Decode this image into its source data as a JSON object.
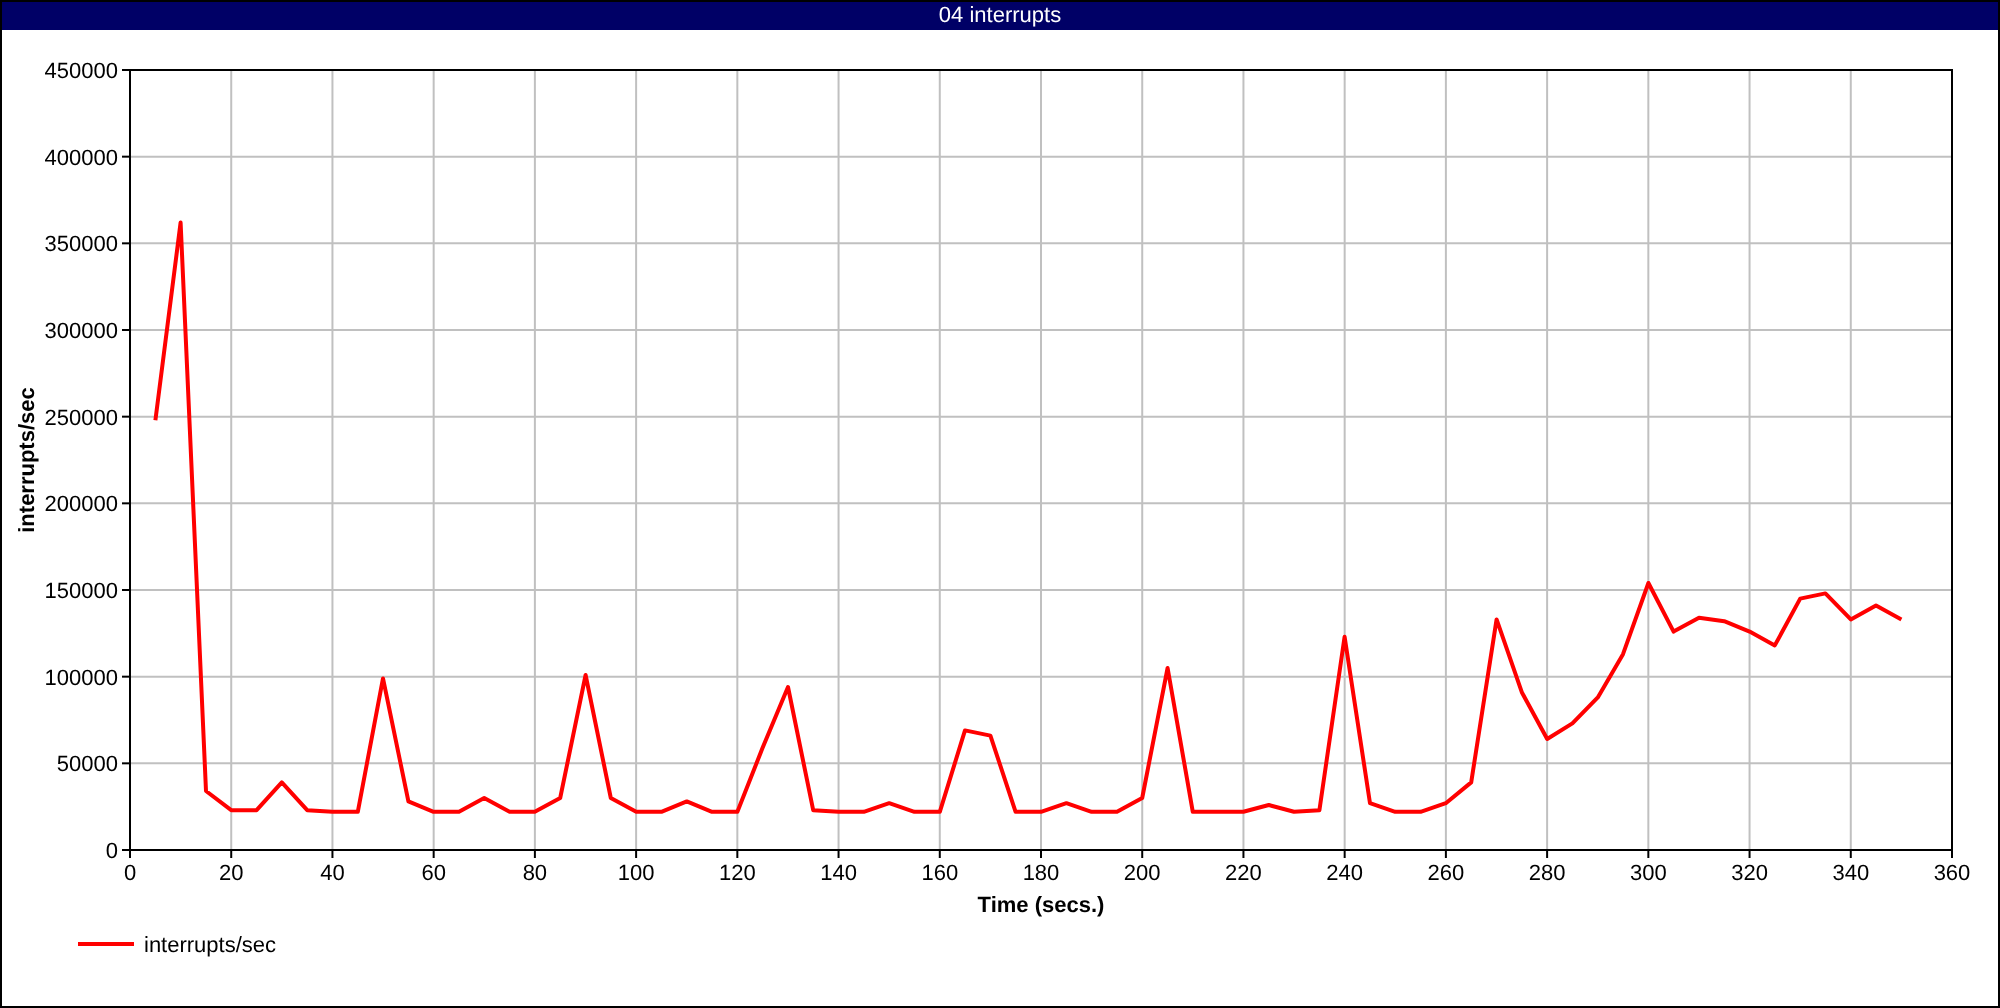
{
  "window": {
    "title": "04 interrupts"
  },
  "chart_data": {
    "type": "line",
    "xlabel": "Time (secs.)",
    "ylabel": "interrupts/sec",
    "x": [
      5,
      10,
      15,
      20,
      25,
      30,
      35,
      40,
      45,
      50,
      55,
      60,
      65,
      70,
      75,
      80,
      85,
      90,
      95,
      100,
      105,
      110,
      115,
      120,
      125,
      130,
      135,
      140,
      145,
      150,
      155,
      160,
      165,
      170,
      175,
      180,
      185,
      190,
      195,
      200,
      205,
      210,
      215,
      220,
      225,
      230,
      235,
      240,
      245,
      250,
      255,
      260,
      265,
      270,
      275,
      280,
      285,
      290,
      295,
      300,
      305,
      310,
      315,
      320,
      325,
      330,
      335,
      340,
      345,
      350
    ],
    "series": [
      {
        "name": "interrupts/sec",
        "color": "#ff0000",
        "values": [
          248000,
          362000,
          34000,
          23000,
          23000,
          39000,
          23000,
          22000,
          22000,
          99000,
          28000,
          22000,
          22000,
          30000,
          22000,
          22000,
          30000,
          101000,
          30000,
          22000,
          22000,
          28000,
          22000,
          22000,
          59000,
          94000,
          23000,
          22000,
          22000,
          27000,
          22000,
          22000,
          69000,
          66000,
          22000,
          22000,
          27000,
          22000,
          22000,
          30000,
          105000,
          22000,
          22000,
          22000,
          26000,
          22000,
          23000,
          123000,
          27000,
          22000,
          22000,
          27000,
          39000,
          133000,
          91000,
          64000,
          73000,
          88000,
          113000,
          154000,
          126000,
          134000,
          132000,
          126000,
          118000,
          145000,
          148000,
          133000,
          141000,
          133000
        ]
      }
    ],
    "grid": true,
    "xlim": [
      0,
      360
    ],
    "ylim": [
      0,
      450000
    ],
    "xticks": [
      0,
      20,
      40,
      60,
      80,
      100,
      120,
      140,
      160,
      180,
      200,
      220,
      240,
      260,
      280,
      300,
      320,
      340,
      360
    ],
    "yticks": [
      0,
      50000,
      100000,
      150000,
      200000,
      250000,
      300000,
      350000,
      400000,
      450000
    ]
  }
}
